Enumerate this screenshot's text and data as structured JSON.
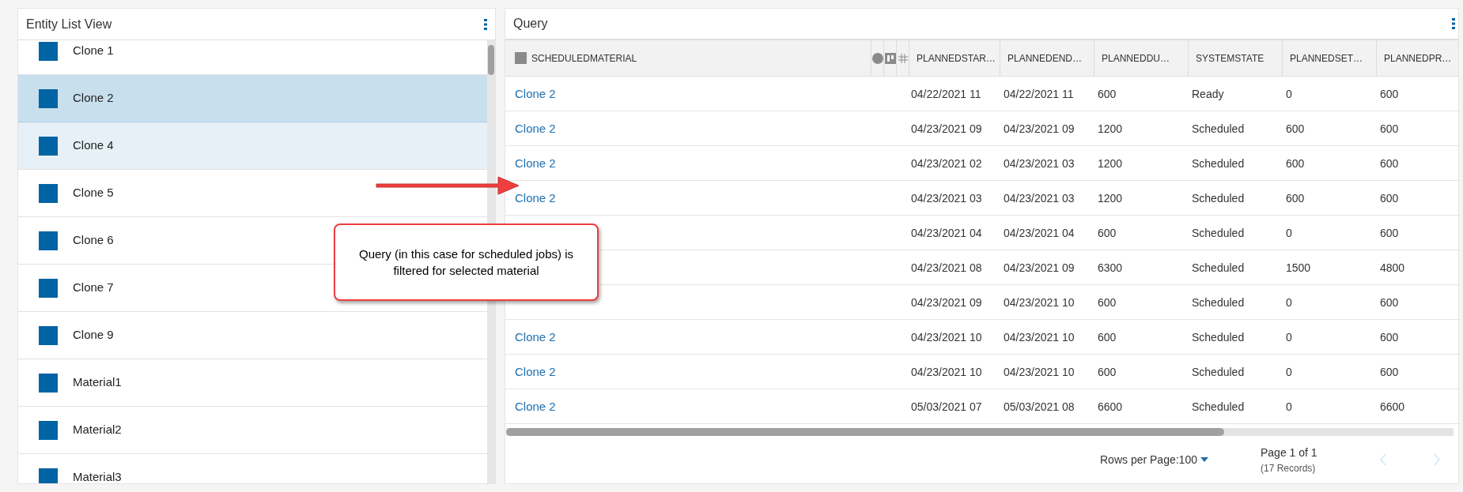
{
  "entity_list": {
    "title": "Entity List View",
    "items": [
      {
        "label": "Clone 1",
        "selected": false,
        "hovered": false
      },
      {
        "label": "Clone 2",
        "selected": true,
        "hovered": false
      },
      {
        "label": "Clone 4",
        "selected": false,
        "hovered": true
      },
      {
        "label": "Clone 5",
        "selected": false,
        "hovered": false
      },
      {
        "label": "Clone 6",
        "selected": false,
        "hovered": false
      },
      {
        "label": "Clone 7",
        "selected": false,
        "hovered": false
      },
      {
        "label": "Clone 9",
        "selected": false,
        "hovered": false
      },
      {
        "label": "Material1",
        "selected": false,
        "hovered": false
      },
      {
        "label": "Material2",
        "selected": false,
        "hovered": false
      },
      {
        "label": "Material3",
        "selected": false,
        "hovered": false
      }
    ]
  },
  "query": {
    "title": "Query",
    "columns": [
      {
        "kind": "text",
        "label": "SCHEDULEDMATERIAL"
      },
      {
        "kind": "dot"
      },
      {
        "kind": "board"
      },
      {
        "kind": "tree"
      },
      {
        "kind": "text",
        "label": "PLANNEDSTAR…"
      },
      {
        "kind": "text",
        "label": "PLANNEDEND…"
      },
      {
        "kind": "text",
        "label": "PLANNEDDU…"
      },
      {
        "kind": "text",
        "label": "SYSTEMSTATE"
      },
      {
        "kind": "text",
        "label": "PLANNEDSET…"
      },
      {
        "kind": "text",
        "label": "PLANNEDPR…"
      }
    ],
    "rows": [
      {
        "cells": [
          "Clone 2",
          "",
          "",
          "",
          "04/22/2021 11",
          "04/22/2021 11",
          "600",
          "Ready",
          "0",
          "600"
        ]
      },
      {
        "cells": [
          "Clone 2",
          "",
          "",
          "",
          "04/23/2021 09",
          "04/23/2021 09",
          "1200",
          "Scheduled",
          "600",
          "600"
        ]
      },
      {
        "cells": [
          "Clone 2",
          "",
          "",
          "",
          "04/23/2021 02",
          "04/23/2021 03",
          "1200",
          "Scheduled",
          "600",
          "600"
        ]
      },
      {
        "cells": [
          "Clone 2",
          "",
          "",
          "",
          "04/23/2021 03",
          "04/23/2021 03",
          "1200",
          "Scheduled",
          "600",
          "600"
        ]
      },
      {
        "cells": [
          "",
          "",
          "",
          "",
          "04/23/2021 04",
          "04/23/2021 04",
          "600",
          "Scheduled",
          "0",
          "600"
        ]
      },
      {
        "cells": [
          "",
          "",
          "",
          "",
          "04/23/2021 08",
          "04/23/2021 09",
          "6300",
          "Scheduled",
          "1500",
          "4800"
        ]
      },
      {
        "cells": [
          "",
          "",
          "",
          "",
          "04/23/2021 09",
          "04/23/2021 10",
          "600",
          "Scheduled",
          "0",
          "600"
        ]
      },
      {
        "cells": [
          "Clone 2",
          "",
          "",
          "",
          "04/23/2021 10",
          "04/23/2021 10",
          "600",
          "Scheduled",
          "0",
          "600"
        ]
      },
      {
        "cells": [
          "Clone 2",
          "",
          "",
          "",
          "04/23/2021 10",
          "04/23/2021 10",
          "600",
          "Scheduled",
          "0",
          "600"
        ]
      },
      {
        "cells": [
          "Clone 2",
          "",
          "",
          "",
          "05/03/2021 07",
          "05/03/2021 08",
          "6600",
          "Scheduled",
          "0",
          "6600"
        ]
      }
    ],
    "footer": {
      "rows_per_page_label": "Rows per Page:",
      "rows_per_page": "100",
      "page": "Page 1 of 1",
      "records": "(17 Records)",
      "previous_disabled": true,
      "next_disabled": true
    }
  },
  "annotation": {
    "text": "Query (in this case for scheduled jobs) is filtered for selected material"
  }
}
